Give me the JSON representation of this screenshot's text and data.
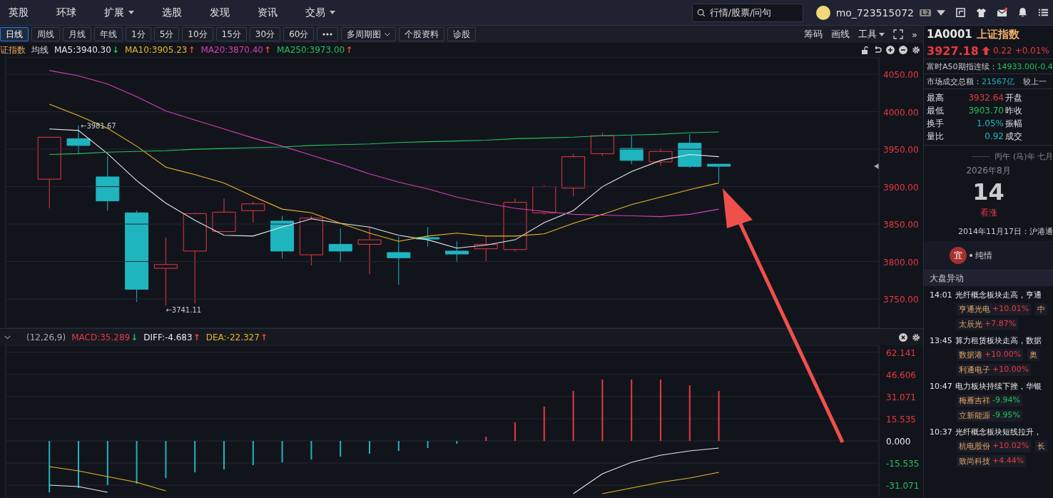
{
  "nav": {
    "items": [
      {
        "label": "英股",
        "dropdown": false
      },
      {
        "label": "环球",
        "dropdown": false
      },
      {
        "label": "扩展",
        "dropdown": true
      },
      {
        "label": "选股",
        "dropdown": false
      },
      {
        "label": "发现",
        "dropdown": false
      },
      {
        "label": "资讯",
        "dropdown": false
      },
      {
        "label": "交易",
        "dropdown": true
      }
    ],
    "search": {
      "placeholder": "行情/股票/问句"
    },
    "user": {
      "name": "mo_723515072",
      "badge": "L2"
    },
    "mail_unread": true
  },
  "toolbar": {
    "periods": [
      {
        "label": "日线",
        "selected": true
      },
      {
        "label": "周线",
        "selected": false
      },
      {
        "label": "月线",
        "selected": false
      },
      {
        "label": "年线",
        "selected": false
      },
      {
        "label": "1分",
        "selected": false
      },
      {
        "label": "5分",
        "selected": false
      },
      {
        "label": "10分",
        "selected": false
      },
      {
        "label": "15分",
        "selected": false
      },
      {
        "label": "30分",
        "selected": false
      },
      {
        "label": "60分",
        "selected": false
      }
    ],
    "tools": [
      {
        "label": "多周期图",
        "dropdown": true
      },
      {
        "label": "个股资料",
        "dropdown": false
      },
      {
        "label": "诊股",
        "dropdown": false
      }
    ],
    "chart_tools": [
      {
        "label": "筹码",
        "dropdown": false
      },
      {
        "label": "画线",
        "dropdown": false
      },
      {
        "label": "工具",
        "dropdown": true
      }
    ],
    "expand": "»"
  },
  "indicator_bar": {
    "index_name": "证指数",
    "type": "均线",
    "legend": [
      {
        "label": "MA5:3940.30",
        "color": "#e8e8e8",
        "arrow": "↓",
        "rising": false
      },
      {
        "label": "MA10:3905.23",
        "color": "#e8b923",
        "arrow": "↑",
        "rising": true
      },
      {
        "label": "MA20:3870.40",
        "color": "#d63fb4",
        "arrow": "↑",
        "rising": true
      },
      {
        "label": "MA250:3973.00",
        "color": "#22c25a",
        "arrow": "↑",
        "rising": true
      }
    ]
  },
  "price_chart": {
    "chart_data": {
      "type": "line",
      "ylim": [
        3711,
        4073
      ],
      "grid": true,
      "yticks": [
        {
          "value": 3750,
          "label": "3750.00"
        },
        {
          "value": 3800,
          "label": "3800.00"
        },
        {
          "value": 3850,
          "label": "3850.00"
        },
        {
          "value": 3900,
          "label": "3900.00"
        },
        {
          "value": 3950,
          "label": "3950.00"
        },
        {
          "value": 4000,
          "label": "4000.00"
        },
        {
          "value": 4050,
          "label": "4050.00"
        }
      ],
      "categories": [
        null,
        null,
        null,
        null,
        null,
        null,
        null,
        null,
        null,
        null,
        null,
        null,
        null,
        null,
        null,
        null,
        null,
        null,
        null,
        null,
        null,
        null,
        null,
        null,
        null,
        null,
        null,
        null,
        null,
        null
      ],
      "series": [
        {
          "color": "#e8e8e8",
          "values": [
            null,
            3977,
            3975,
            3944,
            3908,
            3878,
            3855,
            3835,
            3834,
            3846,
            3857,
            3851,
            3846,
            3835,
            3829,
            3818,
            3822,
            3829,
            3852,
            3868,
            3900,
            3920,
            3935,
            3943,
            3940,
            null,
            null,
            null,
            null,
            null
          ]
        },
        {
          "color": "#e8b923",
          "values": [
            null,
            4010,
            3995,
            3978,
            3954,
            3926,
            3916,
            3905,
            3887,
            3870,
            3865,
            3851,
            3838,
            3827,
            3834,
            3838,
            3834,
            3834,
            3837,
            3851,
            3863,
            3876,
            3886,
            3896,
            3905,
            null,
            null,
            null,
            null,
            null
          ]
        },
        {
          "color": "#d63fb4",
          "values": [
            null,
            4055,
            4048,
            4037,
            4020,
            4001,
            3989,
            3977,
            3965,
            3954,
            3942,
            3930,
            3917,
            3906,
            3897,
            3886,
            3878,
            3871,
            3867,
            3863,
            3862,
            3861,
            3860,
            3863,
            3870,
            null,
            null,
            null,
            null,
            null
          ]
        },
        {
          "color": "#22c25a",
          "values": [
            null,
            3943,
            3944,
            3946,
            3947,
            3948,
            3950,
            3951,
            3952,
            3953,
            3955,
            3956,
            3957,
            3959,
            3960,
            3961,
            3962,
            3964,
            3965,
            3966,
            3968,
            3969,
            3970,
            3972,
            3973,
            null,
            null,
            null,
            null,
            null
          ]
        }
      ],
      "annotations": [
        {
          "text": "←3981.67"
        },
        {
          "text": "←3741.11"
        }
      ]
    }
  },
  "macd_header": {
    "params": "(12,26,9)",
    "legend": [
      {
        "label": "MACD:35.289",
        "color": "#e8393f",
        "arrow": "↓",
        "rising": false
      },
      {
        "label": "DIFF:-4.683",
        "color": "#e8e8e8",
        "arrow": "↑",
        "rising": true
      },
      {
        "label": "DEA:-22.327",
        "color": "#e8b923",
        "arrow": "↑",
        "rising": true
      }
    ]
  },
  "macd_chart": {
    "chart_data": {
      "type": "bar",
      "ylim": [
        -39,
        67
      ],
      "grid": true,
      "yticks": [
        {
          "value": 62.141,
          "label": "62.141"
        },
        {
          "value": 46.606,
          "label": "46.606"
        },
        {
          "value": 31.071,
          "label": "31.071"
        },
        {
          "value": 15.535,
          "label": "15.535"
        },
        {
          "value": 0,
          "label": "0.000"
        },
        {
          "value": -15.535,
          "label": "-15.535"
        },
        {
          "value": -31.071,
          "label": "-31.071"
        }
      ],
      "categories": [
        null,
        null,
        null,
        null,
        null,
        null,
        null,
        null,
        null,
        null,
        null,
        null,
        null,
        null,
        null,
        null,
        null,
        null,
        null,
        null,
        null,
        null,
        null,
        null,
        null,
        null,
        null,
        null,
        null,
        null
      ],
      "series": [
        {
          "type": "bar",
          "colors": [
            null,
            "#1fb5bf",
            "#1fb5bf",
            "#1fb5bf",
            "#1fb5bf",
            "#1fb5bf",
            "#1fb5bf",
            "#1fb5bf",
            "#1fb5bf",
            "#1fb5bf",
            "#1fb5bf",
            "#1fb5bf",
            "#1fb5bf",
            "#1fb5bf",
            "#1fb5bf",
            "#1fb5bf",
            "#e8393f",
            "#e8393f",
            "#e8393f",
            "#e8393f",
            "#e8393f",
            "#e8393f",
            "#e8393f",
            "#e8393f",
            "#e8393f",
            null,
            null,
            null,
            null,
            null
          ],
          "values": [
            null,
            -36,
            -33,
            -31,
            -30,
            -26,
            -22,
            -20,
            -17,
            -15,
            -13,
            -11,
            -9,
            -7,
            -5,
            -2,
            3,
            13,
            24,
            35,
            43,
            43,
            43,
            39,
            35,
            null,
            null,
            null,
            null,
            null
          ]
        },
        {
          "type": "line",
          "color": "#e8e8e8",
          "values": [
            null,
            -31,
            -32,
            -36,
            null,
            null,
            null,
            null,
            null,
            null,
            null,
            null,
            null,
            null,
            null,
            null,
            null,
            null,
            null,
            -37,
            -23,
            -15,
            -10,
            -7,
            -5,
            null,
            null,
            null,
            null,
            null
          ]
        },
        {
          "type": "line",
          "color": "#e8b923",
          "values": [
            null,
            -18,
            -21,
            -25,
            -29,
            -35,
            null,
            null,
            null,
            null,
            null,
            null,
            null,
            null,
            null,
            null,
            null,
            null,
            null,
            null,
            -37,
            -33,
            -29,
            -26,
            -22,
            null,
            null,
            null,
            null,
            null
          ]
        }
      ]
    }
  },
  "quote": {
    "code": "1A0001",
    "name": "上证指数",
    "price": "3927.18",
    "change": "0.22",
    "percent": "+0.01%",
    "rising": true,
    "futures": {
      "label": "富时A50期指连续：",
      "value": "14933.00(-0.4"
    },
    "turnover": {
      "label": "市场成交总额：",
      "value": "21567亿",
      "extra": "较上一"
    },
    "stats": [
      {
        "label": "最高",
        "value": "3932.64",
        "color": "#e8393f",
        "side": "开盘"
      },
      {
        "label": "最低",
        "value": "3903.70",
        "color": "#22c25a",
        "side": "昨收"
      },
      {
        "label": "换手",
        "value": "1.05%",
        "color": "#1fb5bf",
        "side": "振幅"
      },
      {
        "label": "量比",
        "value": "0.92",
        "color": "#1fb5bf",
        "side": "成交"
      }
    ]
  },
  "calendar": {
    "lunar": "丙午 (马)年 七月",
    "month": "2026年8月",
    "day": "14",
    "outlook": "看涨",
    "history": "2014年11月17日：沪港通",
    "advice_badge": "宜",
    "advice": "纯情"
  },
  "market_moves": {
    "title": "大盘异动",
    "events": [
      {
        "time": "14:01",
        "text": "光纤概念板块走高，亨通",
        "rows": [
          [
            {
              "name": "亨通光电",
              "change": "+10.01%",
              "rising": true
            },
            {
              "name": "中"
            }
          ],
          [
            {
              "name": "太辰光",
              "change": "+7.87%",
              "rising": true
            }
          ]
        ]
      },
      {
        "time": "13:45",
        "text": "算力租赁板块走高，数据",
        "rows": [
          [
            {
              "name": "数据港",
              "change": "+10.00%",
              "rising": true
            },
            {
              "name": "奥"
            }
          ],
          [
            {
              "name": "利通电子",
              "change": "+10.00%",
              "rising": true
            }
          ]
        ]
      },
      {
        "time": "10:47",
        "text": "电力板块持续下挫，华银",
        "rows": [
          [
            {
              "name": "梅雁吉祥",
              "change": "-9.94%",
              "rising": false
            }
          ],
          [
            {
              "name": "立新能源",
              "change": "-9.95%",
              "rising": false
            }
          ]
        ]
      },
      {
        "time": "10:37",
        "text": "光纤概念板块短线拉升，",
        "rows": [
          [
            {
              "name": "杭电股份",
              "change": "+10.02%",
              "rising": true
            },
            {
              "name": "长"
            }
          ],
          [
            {
              "name": "致尚科技",
              "change": "+4.44%",
              "rising": true
            }
          ]
        ]
      }
    ]
  }
}
